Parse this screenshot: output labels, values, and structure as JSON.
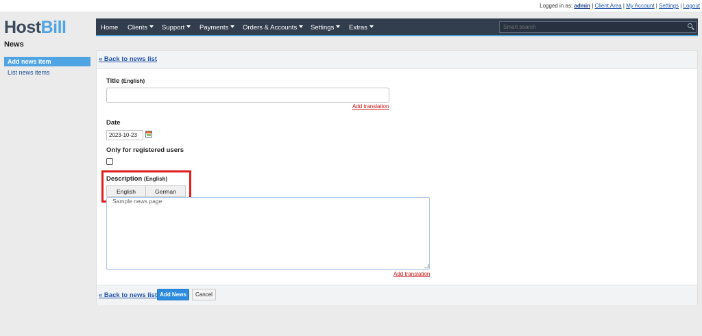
{
  "topbar": {
    "logged_in_label": "Logged in as:",
    "user": "admin",
    "links": [
      "Client Area",
      "My Account",
      "Settings",
      "Logout"
    ],
    "separator": " | "
  },
  "logo": {
    "part1": "Host",
    "part2": "Bill"
  },
  "nav": {
    "items": [
      "Home",
      "Clients",
      "Support",
      "Payments",
      "Orders & Accounts",
      "Settings",
      "Extras"
    ],
    "search_placeholder": "Smart search"
  },
  "section_title": "News",
  "sidebar": {
    "items": [
      {
        "label": "Add news item"
      },
      {
        "label": "List news items"
      }
    ]
  },
  "form": {
    "back_link": "« Back to news list",
    "title_label": "Title",
    "title_lang": "(English)",
    "title_value": "",
    "add_translation": "Add translation",
    "date_label": "Date",
    "date_value": "2023-10-23",
    "registered_label": "Only for registered users",
    "registered_checked": false,
    "description_label": "Description",
    "description_lang": "(English)",
    "tabs": [
      "English",
      "German"
    ],
    "description_value": "Sample news page",
    "add_news_label": "Add News",
    "cancel_label": "Cancel"
  },
  "colors": {
    "nav_bg": "#323d4e",
    "accent": "#4fa4e3",
    "primary_button": "#2e8ce0",
    "highlight": "#e01b1b",
    "link": "#2255aa",
    "translation_link": "#cc1111"
  }
}
